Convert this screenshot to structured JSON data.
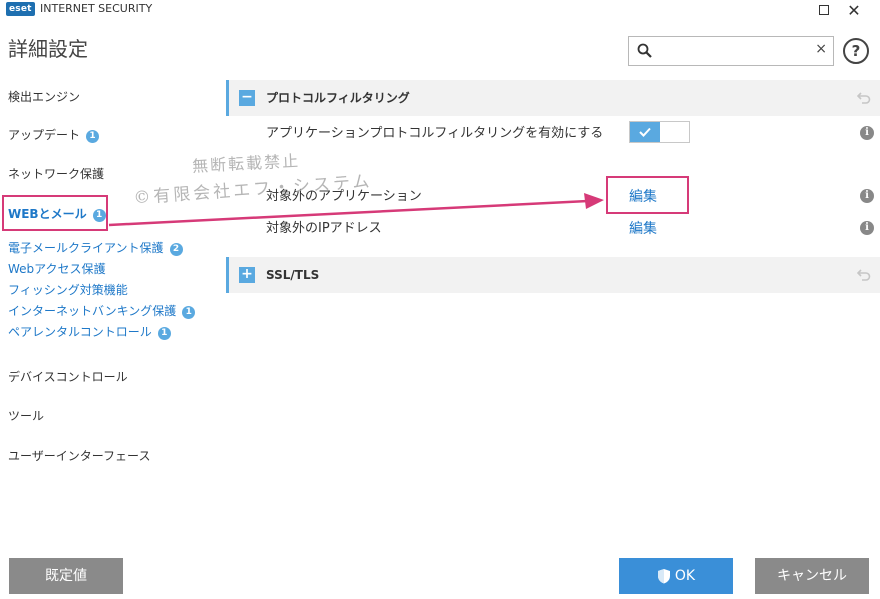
{
  "window": {
    "logo_text": "eset",
    "app_name": "INTERNET SECURITY",
    "maximize_icon": "square-outline",
    "close_icon": "x"
  },
  "header": {
    "title": "詳細設定",
    "search": {
      "value": "",
      "placeholder": "",
      "clear_label": "×"
    },
    "help_label": "?"
  },
  "sidebar": {
    "items": [
      {
        "label": "検出エンジン"
      },
      {
        "label": "アップデート",
        "badge": "1"
      },
      {
        "label": "ネットワーク保護"
      },
      {
        "label": "WEBとメール",
        "badge": "1",
        "active": true
      },
      {
        "label": "電子メールクライアント保護",
        "badge": "2"
      },
      {
        "label": "Webアクセス保護"
      },
      {
        "label": "フィッシング対策機能"
      },
      {
        "label": "インターネットバンキング保護",
        "badge": "1"
      },
      {
        "label": "ペアレンタルコントロール",
        "badge": "1"
      },
      {
        "label": "デバイスコントロール"
      },
      {
        "label": "ツール"
      },
      {
        "label": "ユーザーインターフェース"
      }
    ]
  },
  "main": {
    "section1": {
      "toggle": "−",
      "title": "プロトコルフィルタリング"
    },
    "settings": {
      "enable_label": "アプリケーションプロトコルフィルタリングを有効にする",
      "enable_value": true,
      "excluded_apps_label": "対象外のアプリケーション",
      "excluded_apps_action": "編集",
      "excluded_ip_label": "対象外のIPアドレス",
      "excluded_ip_action": "編集",
      "info_label": "i"
    },
    "section2": {
      "toggle": "+",
      "title": "SSL/TLS"
    }
  },
  "watermark": {
    "line1": "無断転載禁止",
    "line2": "©有限会社エフ・システム"
  },
  "footer": {
    "default_label": "既定値",
    "ok_label": "OK",
    "cancel_label": "キャンセル"
  },
  "colors": {
    "accent": "#5aa9e0",
    "link": "#1e78c8",
    "highlight": "#d63a78",
    "button_gray": "#8a8a8a",
    "button_blue": "#3a8fd8"
  }
}
